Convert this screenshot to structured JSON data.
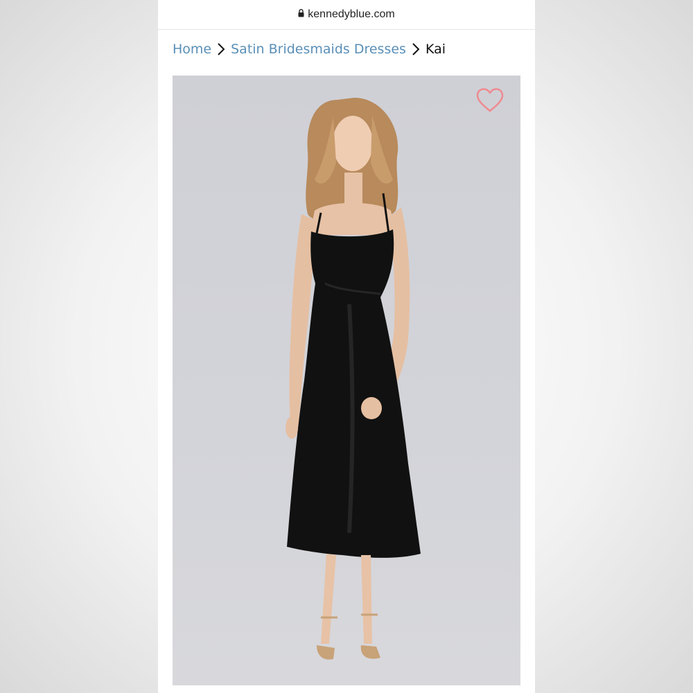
{
  "browser": {
    "domain": "kennedyblue.com",
    "lock_icon": "lock-icon"
  },
  "breadcrumb": {
    "items": [
      "Home",
      "Satin Bridesmaids Dresses"
    ],
    "current": "Kai",
    "separator_icon": "chevron-right-icon"
  },
  "product": {
    "image_subject": "model in black satin midi slip dress",
    "wishlist_icon": "heart-outline-icon"
  },
  "colors": {
    "link": "#5a8fb7",
    "heart": "#ef8a8e",
    "dress": "#111111",
    "image_bg": "#d2d3d8"
  }
}
